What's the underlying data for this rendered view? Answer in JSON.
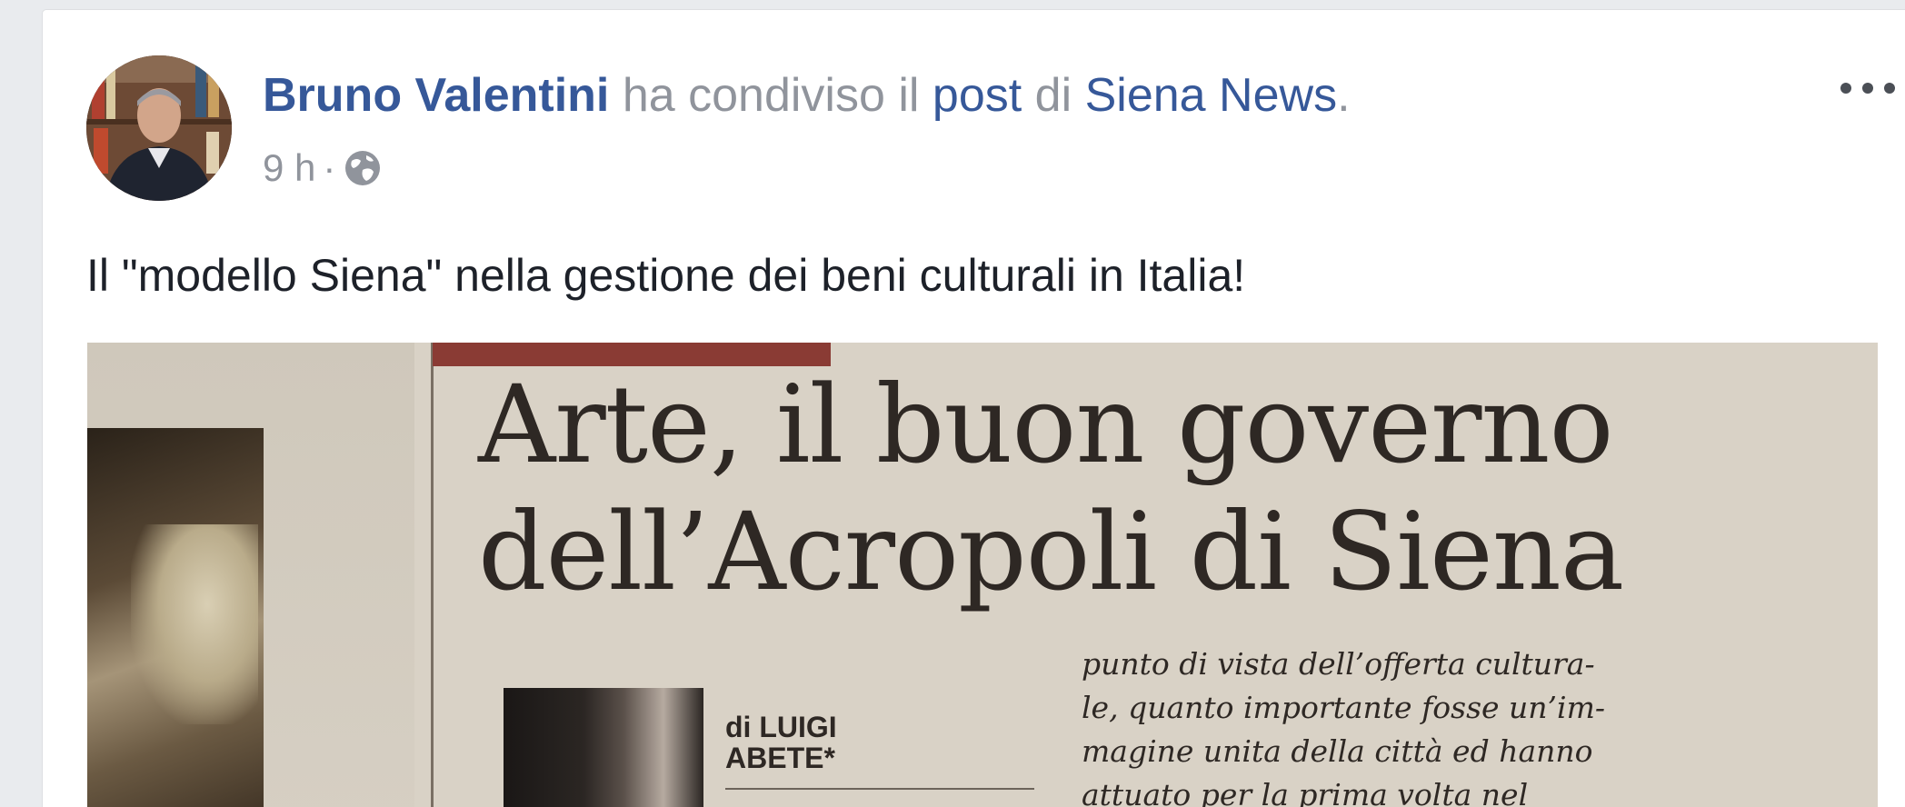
{
  "post": {
    "author": "Bruno Valentini",
    "shared_text": "ha condiviso il",
    "post_link": "post",
    "of_text": "di",
    "page_name": "Siena News",
    "period": ".",
    "timestamp": "9 h",
    "separator": "·",
    "privacy_icon": "globe-icon",
    "more_icon": "more-options-icon",
    "caption": "Il \"modello Siena\" nella gestione dei beni culturali in Italia!"
  },
  "article": {
    "headline_line1": "Arte, il buon governo",
    "headline_line2": "dell’Acropoli di Siena",
    "byline_line1": "di LUIGI",
    "byline_line2": "ABETE*",
    "body_lines": [
      "punto di vista dell’offerta cultura-",
      "le, quanto importante fosse un’im-",
      "magine unita della città ed hanno",
      "attuato per la prima volta nel"
    ]
  },
  "colors": {
    "link": "#365899",
    "meta": "#90949c",
    "text": "#1d2129",
    "page_bg": "#e9ebee"
  }
}
